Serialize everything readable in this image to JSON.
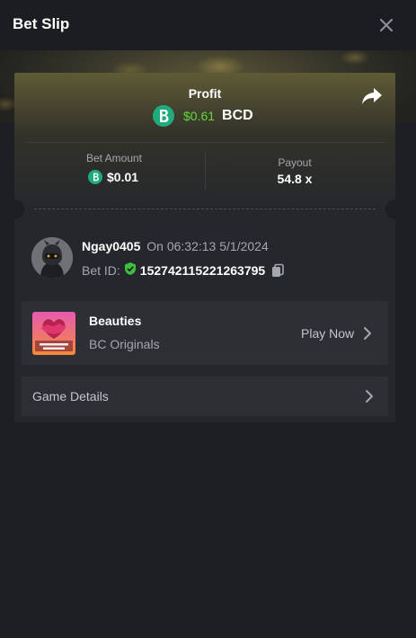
{
  "header": {
    "title": "Bet Slip"
  },
  "icons": {
    "close": "close-icon",
    "share": "share-icon",
    "coin": "bcd-coin-icon",
    "verified": "shield-check-icon",
    "copy": "copy-icon",
    "chevron": "chevron-right-icon"
  },
  "colors": {
    "accent_green": "#5ddc3a",
    "coin_green": "#1fab7e",
    "background": "#1c1e22",
    "card": "#25272c"
  },
  "profit": {
    "label": "Profit",
    "value": "$0.61",
    "currency": "BCD"
  },
  "bet_amount": {
    "label": "Bet Amount",
    "value": "$0.01"
  },
  "payout": {
    "label": "Payout",
    "value": "54.8 x"
  },
  "player": {
    "username": "Ngay0405",
    "time": "On 06:32:13 5/1/2024",
    "bet_id_label": "Bet ID:",
    "bet_id": "152742115221263795"
  },
  "game": {
    "title": "Beauties",
    "provider": "BC Originals",
    "play_label": "Play Now"
  },
  "details": {
    "label": "Game Details"
  }
}
